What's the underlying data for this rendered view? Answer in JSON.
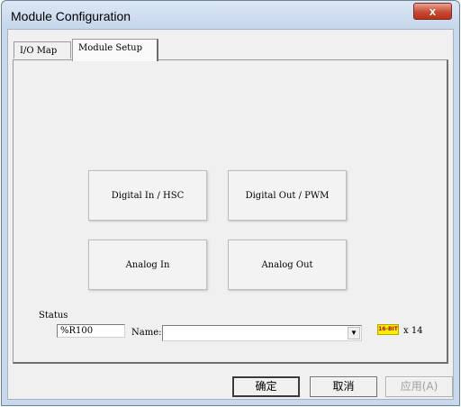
{
  "window": {
    "title": "Module Configuration",
    "close_label": "x"
  },
  "tabs": [
    {
      "label": "I/O Map"
    },
    {
      "label": "Module Setup"
    }
  ],
  "buttons": {
    "digital_in": "Digital In / HSC",
    "digital_out": "Digital Out / PWM",
    "analog_in": "Analog In",
    "analog_out": "Analog Out"
  },
  "status": {
    "label": "Status",
    "address_value": "%R100",
    "name_label": "Name:",
    "name_value": "",
    "badge": "16-BIT",
    "count": "x 14"
  },
  "footer": {
    "ok": "确定",
    "cancel": "取消",
    "apply": "应用(A)"
  },
  "colors": {
    "badge_bg": "#f8f000",
    "close_bg": "#c74a33"
  },
  "icons": {
    "close": "close-icon",
    "dropdown": "chevron-down-icon",
    "badge": "16bit-badge-icon"
  }
}
